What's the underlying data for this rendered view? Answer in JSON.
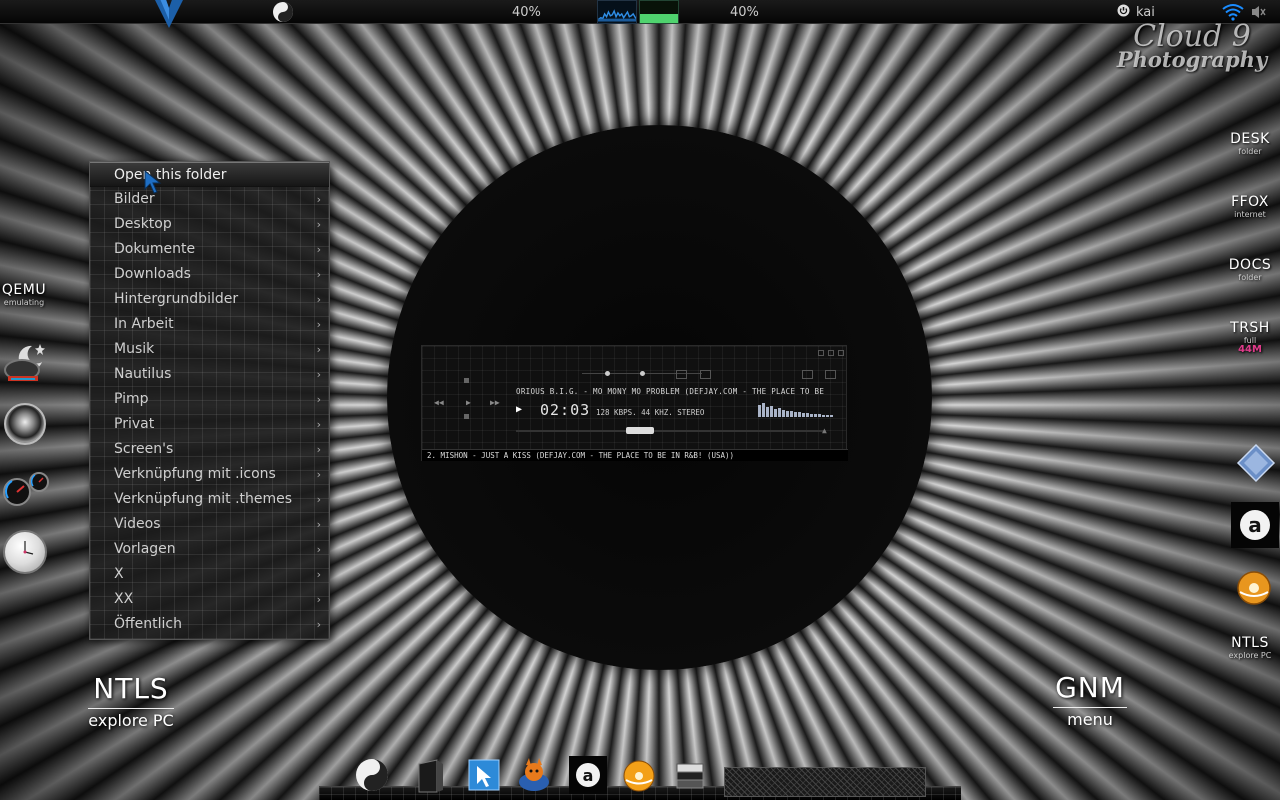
{
  "top_panel": {
    "cpu_percent_label": "40%",
    "mem_percent_label": "40%",
    "mem_usage_fraction": 0.4,
    "user": "kai",
    "accent_color": "#1a8cff"
  },
  "watermark": {
    "line1": "Cloud 9",
    "line2": "Photography"
  },
  "folder_menu": {
    "items": [
      {
        "label": "Open this folder",
        "active": true,
        "submenu": false
      },
      {
        "label": "Bilder",
        "submenu": true
      },
      {
        "label": "Desktop",
        "submenu": true
      },
      {
        "label": "Dokumente",
        "submenu": true
      },
      {
        "label": "Downloads",
        "submenu": true
      },
      {
        "label": "Hintergrundbilder",
        "submenu": true
      },
      {
        "label": "In Arbeit",
        "submenu": true
      },
      {
        "label": "Musik",
        "submenu": true
      },
      {
        "label": "Nautilus",
        "submenu": true
      },
      {
        "label": "Pimp",
        "submenu": true
      },
      {
        "label": "Privat",
        "submenu": true
      },
      {
        "label": "Screen's",
        "submenu": true
      },
      {
        "label": "Verknüpfung mit .icons",
        "submenu": true
      },
      {
        "label": "Verknüpfung mit .themes",
        "submenu": true
      },
      {
        "label": "Videos",
        "submenu": true
      },
      {
        "label": "Vorlagen",
        "submenu": true
      },
      {
        "label": "X",
        "submenu": true
      },
      {
        "label": "XX",
        "submenu": true
      },
      {
        "label": "Öffentlich",
        "submenu": true
      }
    ],
    "arrow_glyph": "›"
  },
  "left_launchers": {
    "qemu": {
      "title": "QEMU",
      "subtitle": "emulating"
    }
  },
  "right_launchers": {
    "desk": {
      "title": "DESK",
      "subtitle": "folder"
    },
    "ffox": {
      "title": "FFOX",
      "subtitle": "internet"
    },
    "docs": {
      "title": "DOCS",
      "subtitle": "folder"
    },
    "trsh": {
      "title": "TRSH",
      "subtitle": "full",
      "size": "44M"
    },
    "ntls": {
      "title": "NTLS",
      "subtitle": "explore PC"
    }
  },
  "big_launchers": {
    "ntls": {
      "title": "NTLS",
      "subtitle": "explore PC"
    },
    "gnm": {
      "title": "GNM",
      "subtitle": "menu"
    }
  },
  "media_player": {
    "track_title": "ORIOUS B.I.G. - MO MONY MO PROBLEM (DEFJAY.COM - THE PLACE TO BE",
    "play_glyph": "▶",
    "time": "02:03",
    "bitrate_info": "128 KBPS. 44 KHZ. STEREO",
    "playlist_entry": "2. MISHON - JUST A KISS (DEFJAY.COM - THE PLACE TO BE IN R&B! (USA))",
    "seek_fraction": 0.4,
    "prev_glyph": "◀◀",
    "play_btn_glyph": "▶",
    "next_glyph": "▶▶",
    "eject_glyph": "▲"
  },
  "dock": {
    "icons": [
      "swirl-icon",
      "box-icon",
      "blue-window-icon",
      "fox-icon",
      "amazon-icon",
      "cd-icon",
      "stack-icon"
    ]
  }
}
